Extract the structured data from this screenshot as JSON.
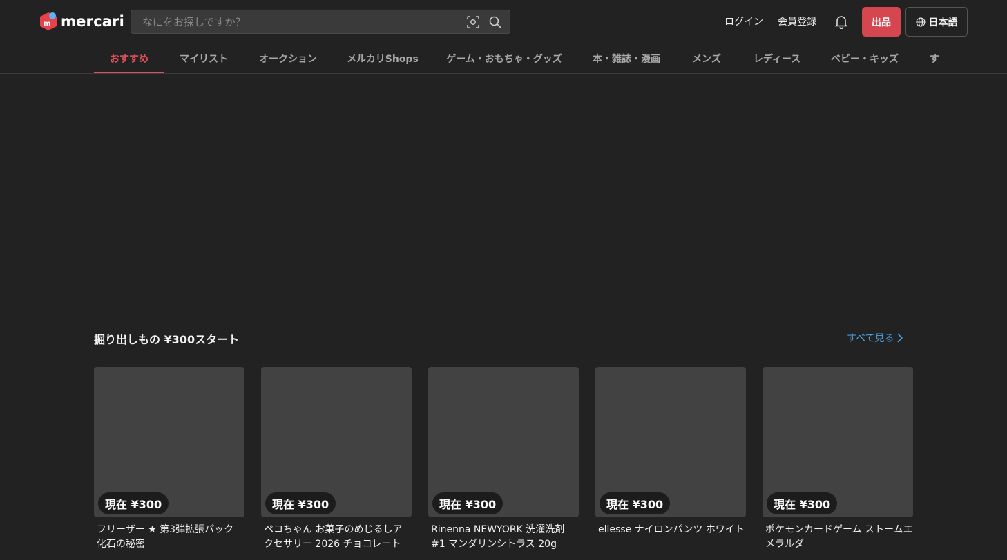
{
  "header": {
    "logo_text": "mercari",
    "search_placeholder": "なにをお探しですか？",
    "login_label": "ログイン",
    "signup_label": "会員登録",
    "sell_label": "出品",
    "language_label": "日本語",
    "icons": [
      "camera-scan-icon",
      "search-icon",
      "bell-icon",
      "globe-icon"
    ],
    "colors": {
      "brand_red": "#d6464f",
      "accent_blue": "#4ea3e6"
    }
  },
  "tabs": [
    {
      "label": "おすすめ",
      "active": true
    },
    {
      "label": "マイリスト"
    },
    {
      "label": "オークション"
    },
    {
      "label": "メルカリShops"
    },
    {
      "label": "ゲーム・おもちゃ・グッズ"
    },
    {
      "label": "本・雑誌・漫画"
    },
    {
      "label": "メンズ"
    },
    {
      "label": "レディース"
    },
    {
      "label": "ベビー・キッズ"
    },
    {
      "label": "す"
    }
  ],
  "section": {
    "title": "掘り出しもの ¥300スタート",
    "see_all_label": "すべて見る"
  },
  "items": [
    {
      "price": "現在 ¥300",
      "name": "フリーザー ★ 第3弾拡張パック 化石の秘密"
    },
    {
      "price": "現在 ¥300",
      "name": "ペコちゃん お菓子のめじるしアクセサリー 2026 チョコレート"
    },
    {
      "price": "現在 ¥300",
      "name": "Rinenna NEWYORK 洗濯洗剤 #1 マンダリンシトラス 20g"
    },
    {
      "price": "現在 ¥300",
      "name": "ellesse ナイロンパンツ ホワイト"
    },
    {
      "price": "現在 ¥300",
      "name": "ポケモンカードゲーム ストームエメラルダ"
    }
  ]
}
